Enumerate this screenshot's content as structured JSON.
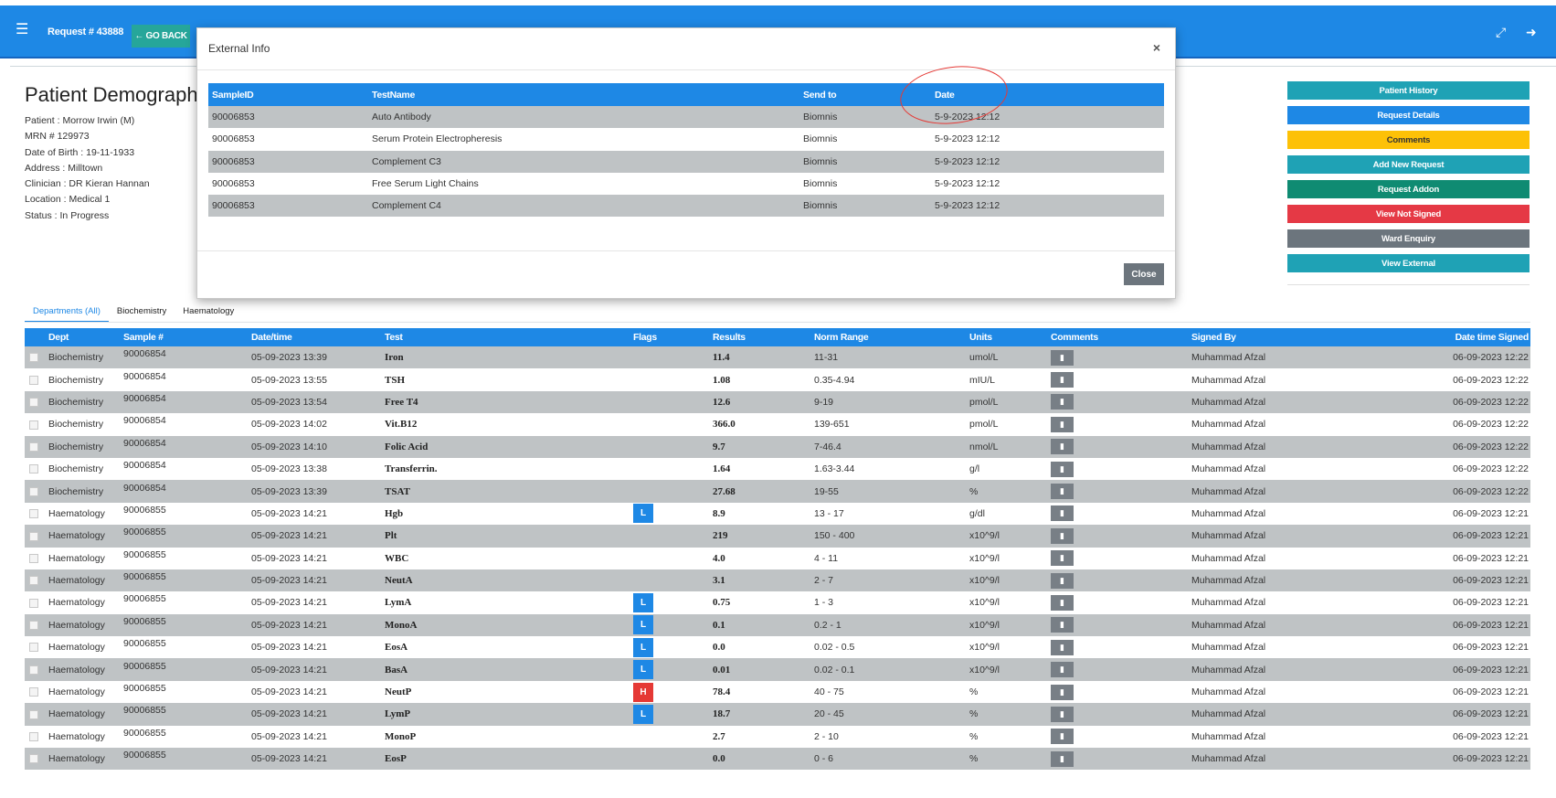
{
  "header": {
    "menu_icon": "hamburger-icon",
    "request_title": "Request # 43888",
    "go_back_label": "← GO BACK",
    "expand_icon": "expand-icon",
    "logout_icon": "logout-icon"
  },
  "patient": {
    "title": "Patient Demographi",
    "lines": [
      "Patient : Morrow Irwin (M)",
      "MRN # 129973",
      "Date of Birth : 19-11-1933",
      "Address : Milltown",
      "Clinician : DR Kieran Hannan",
      "Location : Medical 1",
      "Status : In Progress"
    ]
  },
  "side_buttons": [
    {
      "label": "Patient History",
      "color": "#1fa2b5"
    },
    {
      "label": "Request Details",
      "color": "#1e88e5"
    },
    {
      "label": "Comments",
      "color": "#fdc107",
      "text_color": "#333333"
    },
    {
      "label": "Add New Request",
      "color": "#1fa2b5"
    },
    {
      "label": "Request Addon",
      "color": "#0f8b72"
    },
    {
      "label": "View Not Signed",
      "color": "#e53945"
    },
    {
      "label": "Ward Enquiry",
      "color": "#6c757d"
    },
    {
      "label": "View External",
      "color": "#1fa2b5"
    }
  ],
  "tabs": [
    {
      "label": "Departments (All)",
      "active": true
    },
    {
      "label": "Biochemistry",
      "active": false
    },
    {
      "label": "Haematology",
      "active": false
    }
  ],
  "results_table": {
    "columns": [
      "Dept",
      "Sample #",
      "Date/time",
      "Test",
      "Flags",
      "Results",
      "Norm Range",
      "Units",
      "Comments",
      "Signed By",
      "Date time Signed"
    ],
    "rows": [
      {
        "dept": "Biochemistry",
        "sample": "90006854",
        "datetime": "05-09-2023 13:39",
        "test": "Iron",
        "flag": "",
        "result": "11.4",
        "range": "11-31",
        "units": "umol/L",
        "signed_by": "Muhammad Afzal",
        "signed": "06-09-2023 12:22"
      },
      {
        "dept": "Biochemistry",
        "sample": "90006854",
        "datetime": "05-09-2023 13:55",
        "test": "TSH",
        "flag": "",
        "result": "1.08",
        "range": "0.35-4.94",
        "units": "mIU/L",
        "signed_by": "Muhammad Afzal",
        "signed": "06-09-2023 12:22"
      },
      {
        "dept": "Biochemistry",
        "sample": "90006854",
        "datetime": "05-09-2023 13:54",
        "test": "Free T4",
        "flag": "",
        "result": "12.6",
        "range": "9-19",
        "units": "pmol/L",
        "signed_by": "Muhammad Afzal",
        "signed": "06-09-2023 12:22"
      },
      {
        "dept": "Biochemistry",
        "sample": "90006854",
        "datetime": "05-09-2023 14:02",
        "test": "Vit.B12",
        "flag": "",
        "result": "366.0",
        "range": "139-651",
        "units": "pmol/L",
        "signed_by": "Muhammad Afzal",
        "signed": "06-09-2023 12:22"
      },
      {
        "dept": "Biochemistry",
        "sample": "90006854",
        "datetime": "05-09-2023 14:10",
        "test": "Folic Acid",
        "flag": "",
        "result": "9.7",
        "range": "7-46.4",
        "units": "nmol/L",
        "signed_by": "Muhammad Afzal",
        "signed": "06-09-2023 12:22"
      },
      {
        "dept": "Biochemistry",
        "sample": "90006854",
        "datetime": "05-09-2023 13:38",
        "test": "Transferrin.",
        "flag": "",
        "result": "1.64",
        "range": "1.63-3.44",
        "units": "g/l",
        "signed_by": "Muhammad Afzal",
        "signed": "06-09-2023 12:22"
      },
      {
        "dept": "Biochemistry",
        "sample": "90006854",
        "datetime": "05-09-2023 13:39",
        "test": "TSAT",
        "flag": "",
        "result": "27.68",
        "range": "19-55",
        "units": "%",
        "signed_by": "Muhammad Afzal",
        "signed": "06-09-2023 12:22"
      },
      {
        "dept": "Haematology",
        "sample": "90006855",
        "datetime": "05-09-2023 14:21",
        "test": "Hgb",
        "flag": "L",
        "result": "8.9",
        "range": "13 - 17",
        "units": "g/dl",
        "signed_by": "Muhammad Afzal",
        "signed": "06-09-2023 12:21"
      },
      {
        "dept": "Haematology",
        "sample": "90006855",
        "datetime": "05-09-2023 14:21",
        "test": "Plt",
        "flag": "",
        "result": "219",
        "range": "150 - 400",
        "units": "x10^9/l",
        "signed_by": "Muhammad Afzal",
        "signed": "06-09-2023 12:21"
      },
      {
        "dept": "Haematology",
        "sample": "90006855",
        "datetime": "05-09-2023 14:21",
        "test": "WBC",
        "flag": "",
        "result": "4.0",
        "range": "4 - 11",
        "units": "x10^9/l",
        "signed_by": "Muhammad Afzal",
        "signed": "06-09-2023 12:21"
      },
      {
        "dept": "Haematology",
        "sample": "90006855",
        "datetime": "05-09-2023 14:21",
        "test": "NeutA",
        "flag": "",
        "result": "3.1",
        "range": "2 - 7",
        "units": "x10^9/l",
        "signed_by": "Muhammad Afzal",
        "signed": "06-09-2023 12:21"
      },
      {
        "dept": "Haematology",
        "sample": "90006855",
        "datetime": "05-09-2023 14:21",
        "test": "LymA",
        "flag": "L",
        "result": "0.75",
        "range": "1 - 3",
        "units": "x10^9/l",
        "signed_by": "Muhammad Afzal",
        "signed": "06-09-2023 12:21"
      },
      {
        "dept": "Haematology",
        "sample": "90006855",
        "datetime": "05-09-2023 14:21",
        "test": "MonoA",
        "flag": "L",
        "result": "0.1",
        "range": "0.2 - 1",
        "units": "x10^9/l",
        "signed_by": "Muhammad Afzal",
        "signed": "06-09-2023 12:21"
      },
      {
        "dept": "Haematology",
        "sample": "90006855",
        "datetime": "05-09-2023 14:21",
        "test": "EosA",
        "flag": "L",
        "result": "0.0",
        "range": "0.02 - 0.5",
        "units": "x10^9/l",
        "signed_by": "Muhammad Afzal",
        "signed": "06-09-2023 12:21"
      },
      {
        "dept": "Haematology",
        "sample": "90006855",
        "datetime": "05-09-2023 14:21",
        "test": "BasA",
        "flag": "L",
        "result": "0.01",
        "range": "0.02 - 0.1",
        "units": "x10^9/l",
        "signed_by": "Muhammad Afzal",
        "signed": "06-09-2023 12:21"
      },
      {
        "dept": "Haematology",
        "sample": "90006855",
        "datetime": "05-09-2023 14:21",
        "test": "NeutP",
        "flag": "H",
        "result": "78.4",
        "range": "40 - 75",
        "units": "%",
        "signed_by": "Muhammad Afzal",
        "signed": "06-09-2023 12:21"
      },
      {
        "dept": "Haematology",
        "sample": "90006855",
        "datetime": "05-09-2023 14:21",
        "test": "LymP",
        "flag": "L",
        "result": "18.7",
        "range": "20 - 45",
        "units": "%",
        "signed_by": "Muhammad Afzal",
        "signed": "06-09-2023 12:21"
      },
      {
        "dept": "Haematology",
        "sample": "90006855",
        "datetime": "05-09-2023 14:21",
        "test": "MonoP",
        "flag": "",
        "result": "2.7",
        "range": "2 - 10",
        "units": "%",
        "signed_by": "Muhammad Afzal",
        "signed": "06-09-2023 12:21"
      },
      {
        "dept": "Haematology",
        "sample": "90006855",
        "datetime": "05-09-2023 14:21",
        "test": "EosP",
        "flag": "",
        "result": "0.0",
        "range": "0 - 6",
        "units": "%",
        "signed_by": "Muhammad Afzal",
        "signed": "06-09-2023 12:21"
      }
    ]
  },
  "modal": {
    "title": "External Info",
    "close_icon": "×",
    "columns": [
      "SampleID",
      "TestName",
      "Send to",
      "Date"
    ],
    "rows": [
      {
        "sample_id": "90006853",
        "test_name": "Auto Antibody",
        "send_to": "Biomnis",
        "date": "5-9-2023 12:12"
      },
      {
        "sample_id": "90006853",
        "test_name": "Serum Protein Electropheresis",
        "send_to": "Biomnis",
        "date": "5-9-2023 12:12"
      },
      {
        "sample_id": "90006853",
        "test_name": "Complement C3",
        "send_to": "Biomnis",
        "date": "5-9-2023 12:12"
      },
      {
        "sample_id": "90006853",
        "test_name": "Free Serum Light Chains",
        "send_to": "Biomnis",
        "date": "5-9-2023 12:12"
      },
      {
        "sample_id": "90006853",
        "test_name": "Complement C4",
        "send_to": "Biomnis",
        "date": "5-9-2023 12:12"
      }
    ],
    "close_button_label": "Close"
  },
  "colors": {
    "primary": "#1e88e5",
    "row_shade": "#bfc3c5",
    "flag_low": "#1e88e5",
    "flag_high": "#e53935",
    "annotation": "#e53935"
  }
}
